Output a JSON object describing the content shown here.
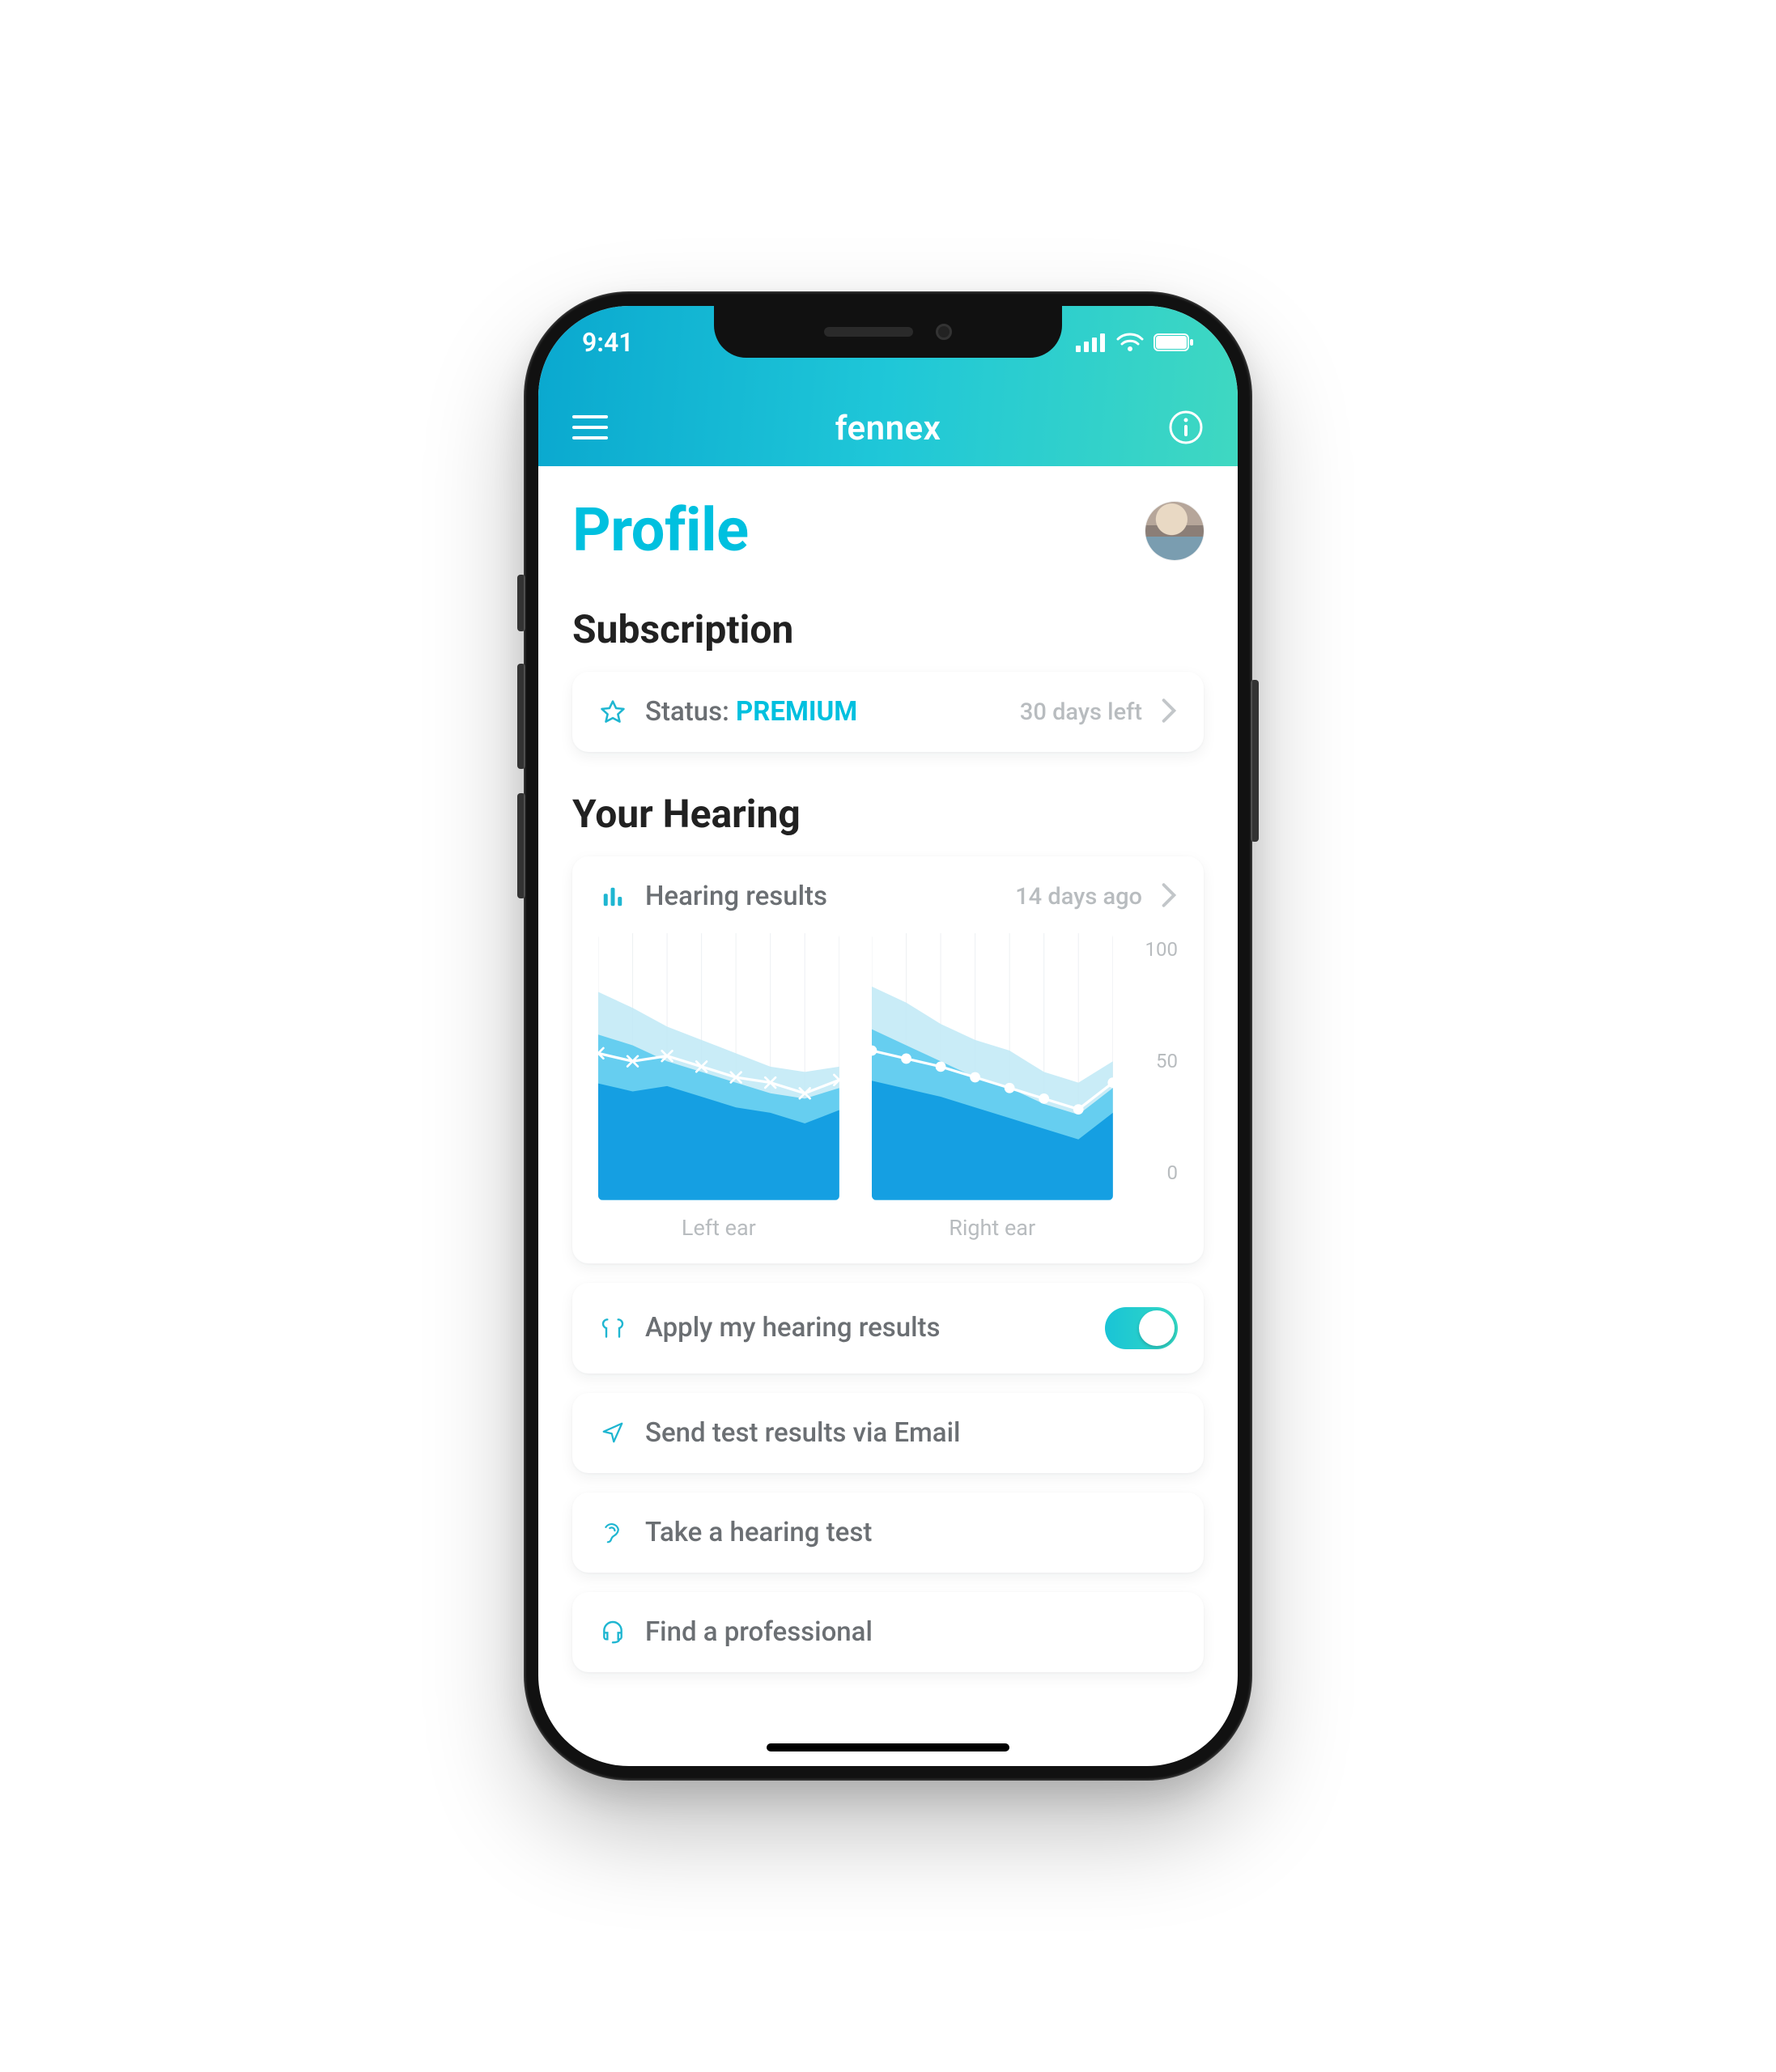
{
  "status_bar": {
    "time": "9:41"
  },
  "header": {
    "app_name": "fennex"
  },
  "page": {
    "title": "Profile"
  },
  "subscription": {
    "heading": "Subscription",
    "status_prefix": "Status: ",
    "status_value": "PREMIUM",
    "days_left": "30 days left"
  },
  "hearing": {
    "heading": "Your Hearing",
    "results_label": "Hearing results",
    "results_meta": "14 days ago",
    "left_caption": "Left ear",
    "right_caption": "Right ear",
    "axis": {
      "max": "100",
      "mid": "50",
      "min": "0"
    }
  },
  "actions": {
    "apply": "Apply my hearing results",
    "email": "Send test results via Email",
    "test": "Take a hearing test",
    "pro": "Find a professional"
  },
  "toggles": {
    "apply_results": true
  },
  "colors": {
    "teal": "#1fb6d1",
    "teal_bright": "#00c0df",
    "green": "#30d8c1"
  },
  "chart_data": [
    {
      "type": "area",
      "title": "Left ear",
      "ylim": [
        0,
        100
      ],
      "x": [
        1,
        2,
        3,
        4,
        5,
        6,
        7,
        8
      ],
      "series": [
        {
          "name": "band-back",
          "values": [
            78,
            72,
            65,
            60,
            55,
            50,
            48,
            50
          ]
        },
        {
          "name": "band-mid",
          "values": [
            62,
            58,
            52,
            48,
            44,
            40,
            38,
            42
          ]
        },
        {
          "name": "line",
          "values": [
            55,
            52,
            54,
            50,
            46,
            44,
            40,
            45
          ],
          "marker": "x"
        }
      ]
    },
    {
      "type": "area",
      "title": "Right ear",
      "ylim": [
        0,
        100
      ],
      "x": [
        1,
        2,
        3,
        4,
        5,
        6,
        7,
        8
      ],
      "series": [
        {
          "name": "band-back",
          "values": [
            80,
            74,
            66,
            60,
            56,
            48,
            44,
            52
          ]
        },
        {
          "name": "band-mid",
          "values": [
            64,
            58,
            52,
            46,
            42,
            36,
            32,
            42
          ]
        },
        {
          "name": "line",
          "values": [
            56,
            53,
            50,
            46,
            42,
            38,
            34,
            44
          ],
          "marker": "o"
        }
      ]
    }
  ]
}
